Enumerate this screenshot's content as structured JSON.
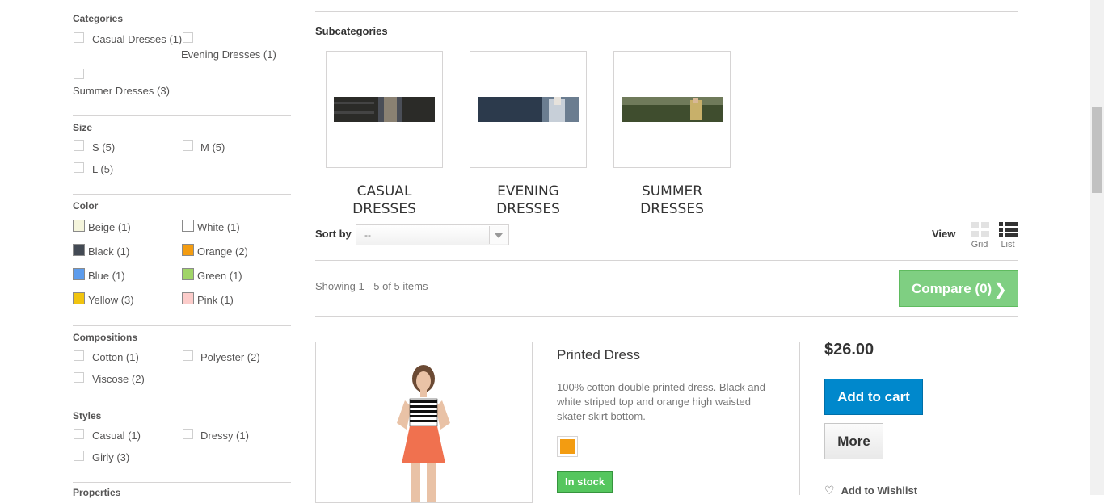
{
  "filters": {
    "categories": {
      "title": "Categories",
      "options": [
        "Casual Dresses (1)",
        "Evening Dresses (1)",
        "Summer Dresses (3)"
      ]
    },
    "size": {
      "title": "Size",
      "options": [
        "S (5)",
        "M (5)",
        "L (5)"
      ]
    },
    "color": {
      "title": "Color",
      "options": [
        {
          "label": "Beige (1)",
          "color": "#f5f5dc"
        },
        {
          "label": "White (1)",
          "color": "#ffffff"
        },
        {
          "label": "Black (1)",
          "color": "#434a54"
        },
        {
          "label": "Orange (2)",
          "color": "#f39c11"
        },
        {
          "label": "Blue (1)",
          "color": "#5d9cec"
        },
        {
          "label": "Green (1)",
          "color": "#a0d468"
        },
        {
          "label": "Yellow (3)",
          "color": "#f1c40f"
        },
        {
          "label": "Pink (1)",
          "color": "#fcccca"
        }
      ]
    },
    "compositions": {
      "title": "Compositions",
      "options": [
        "Cotton (1)",
        "Polyester (2)",
        "Viscose (2)"
      ]
    },
    "styles": {
      "title": "Styles",
      "options": [
        "Casual (1)",
        "Dressy (1)",
        "Girly (3)"
      ]
    },
    "properties": {
      "title": "Properties"
    }
  },
  "subcategories": {
    "title": "Subcategories",
    "items": [
      {
        "name": "Casual Dresses"
      },
      {
        "name": "Evening Dresses"
      },
      {
        "name": "Summer Dresses"
      }
    ]
  },
  "toolbar": {
    "sort_label": "Sort by",
    "sort_value": "--",
    "view_label": "View",
    "grid_label": "Grid",
    "list_label": "List",
    "showing": "Showing 1 - 5 of 5 items",
    "compare_label": "Compare (0)"
  },
  "product": {
    "name": "Printed Dress",
    "description": "100% cotton double printed dress. Black and white striped top and orange high waisted skater skirt bottom.",
    "swatch_color": "#f39c11",
    "stock": "In stock",
    "price": "$26.00",
    "add_to_cart": "Add to cart",
    "more": "More",
    "wishlist": "Add to Wishlist"
  },
  "colors": {
    "accent_blue": "#0088cc",
    "compare_green": "#7fcf82",
    "stock_green": "#55c65e"
  }
}
